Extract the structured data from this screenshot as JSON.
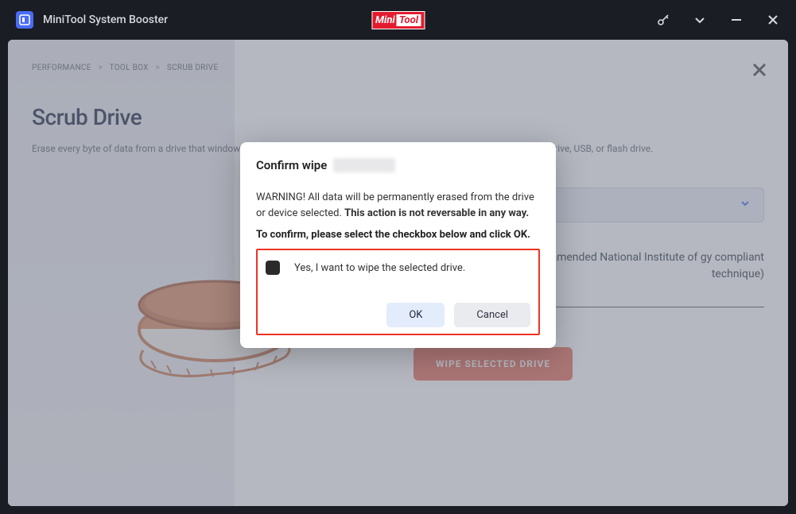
{
  "titlebar": {
    "app_title": "MiniTool System Booster",
    "brand_a": "Mini",
    "brand_b": "Tool"
  },
  "breadcrumb": {
    "a": "PERFORMANCE",
    "b": "TOOL BOX",
    "c": "SCRUB DRIVE"
  },
  "page": {
    "title": "Scrub Drive",
    "description": "Erase every byte of data from a drive that windows is not installed on including removable devices such as a portable hard drive, USB, or flash drive."
  },
  "method": {
    "line": "mmended National Institute of gy compliant technique)"
  },
  "actions": {
    "wipe": "WIPE SELECTED DRIVE"
  },
  "modal": {
    "title": "Confirm wipe",
    "warning_a": "WARNING! All data will be permanently erased from the drive or device selected. ",
    "warning_b": "This action is not reversable in any way.",
    "confirm_instr": "To confirm, please select the checkbox below and click OK.",
    "checkbox_label": "Yes, I want to wipe the selected drive.",
    "ok": "OK",
    "cancel": "Cancel"
  }
}
